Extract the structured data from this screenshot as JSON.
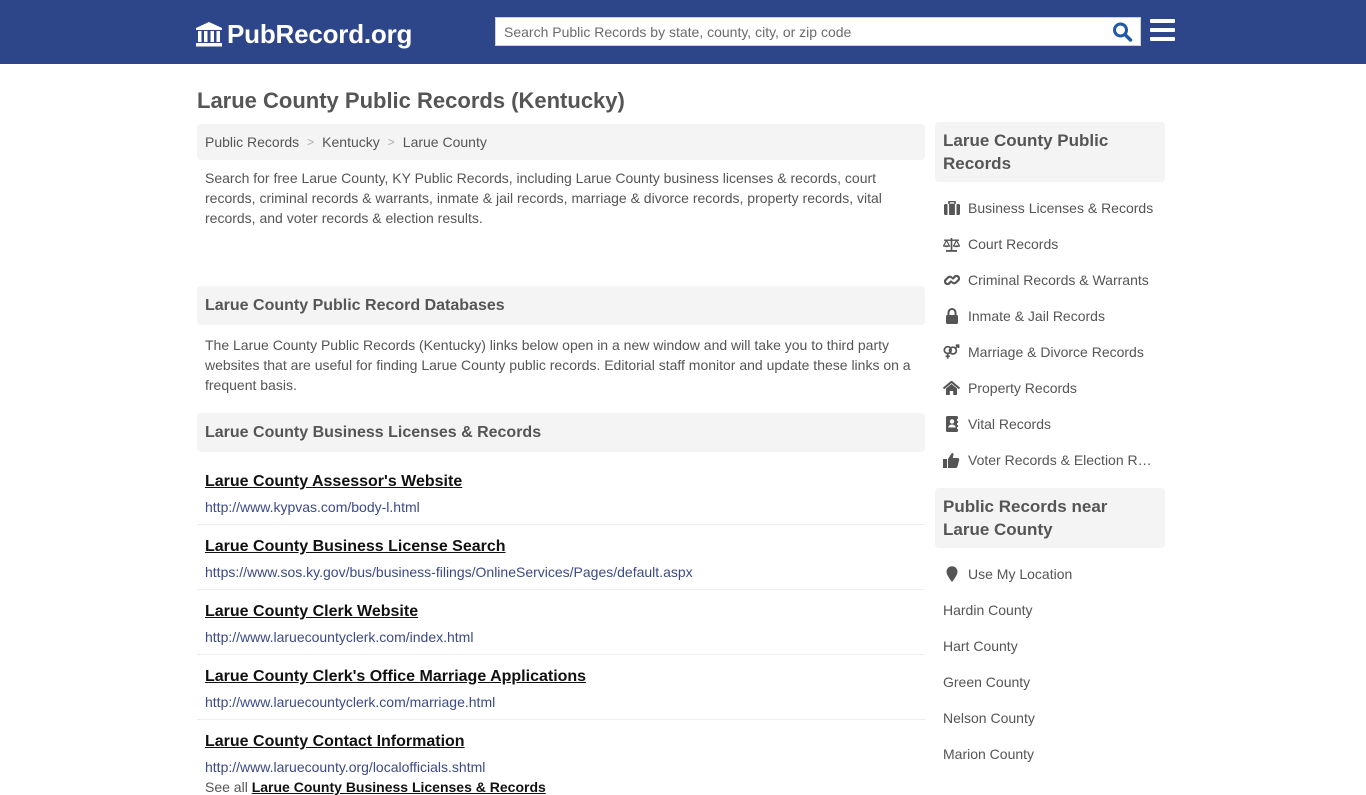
{
  "header": {
    "logo_text": "PubRecord.org",
    "search_placeholder": "Search Public Records by state, county, city, or zip code",
    "search_value": "",
    "colors": {
      "bar": "#2d4689",
      "search_icon": "#1f5aa6"
    }
  },
  "page": {
    "title": "Larue County Public Records (Kentucky)"
  },
  "breadcrumb": [
    {
      "label": "Public Records"
    },
    {
      "label": "Kentucky"
    },
    {
      "label": "Larue County"
    }
  ],
  "breadcrumb_separator": ">",
  "intro_text": "Search for free Larue County, KY Public Records, including Larue County business licenses & records, court records, criminal records & warrants, inmate & jail records, marriage & divorce records, property records, vital records, and voter records & election results.",
  "databases": {
    "heading": "Larue County Public Record Databases",
    "description": "The Larue County Public Records (Kentucky) links below open in a new window and will take you to third party websites that are useful for finding Larue County public records. Editorial staff monitor and update these links on a frequent basis."
  },
  "business_section": {
    "heading": "Larue County Business Licenses & Records",
    "links": [
      {
        "title": "Larue County Assessor's Website",
        "url": "http://www.kypvas.com/body-l.html"
      },
      {
        "title": "Larue County Business License Search",
        "url": "https://www.sos.ky.gov/bus/business-filings/OnlineServices/Pages/default.aspx"
      },
      {
        "title": "Larue County Clerk Website",
        "url": "http://www.laruecountyclerk.com/index.html"
      },
      {
        "title": "Larue County Clerk's Office Marriage Applications",
        "url": "http://www.laruecountyclerk.com/marriage.html"
      },
      {
        "title": "Larue County Contact Information",
        "url": "http://www.laruecounty.org/localofficials.shtml"
      }
    ],
    "see_all_prefix": "See all",
    "see_all_link": "Larue County Business Licenses & Records"
  },
  "sidebar": {
    "records_heading": "Larue County Public Records",
    "records": [
      {
        "label": "Business Licenses & Records",
        "icon": "briefcase-icon"
      },
      {
        "label": "Court Records",
        "icon": "balance-scale-icon"
      },
      {
        "label": "Criminal Records & Warrants",
        "icon": "link-icon"
      },
      {
        "label": "Inmate & Jail Records",
        "icon": "lock-icon"
      },
      {
        "label": "Marriage & Divorce Records",
        "icon": "venus-mars-icon"
      },
      {
        "label": "Property Records",
        "icon": "home-icon"
      },
      {
        "label": "Vital Records",
        "icon": "address-book-icon"
      },
      {
        "label": "Voter Records & Election Results",
        "icon": "thumbs-up-icon"
      }
    ],
    "near_heading": "Public Records near Larue County",
    "use_location": "Use My Location",
    "near": [
      {
        "label": "Hardin County"
      },
      {
        "label": "Hart County"
      },
      {
        "label": "Green County"
      },
      {
        "label": "Nelson County"
      },
      {
        "label": "Marion County"
      }
    ]
  }
}
